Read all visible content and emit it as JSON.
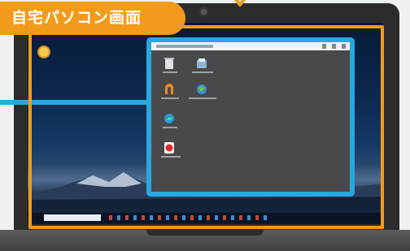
{
  "label": {
    "text": "自宅パソコン画面"
  },
  "colors": {
    "accent_orange": "#f29b1a",
    "accent_blue": "#29a8e0",
    "laptop_body": "#2c2c2e"
  },
  "remote_window": {
    "icons": [
      "recycle-bin-icon",
      "folder-icon",
      "app-icon",
      "globe-icon",
      "edge-icon",
      "red-app-icon"
    ]
  }
}
